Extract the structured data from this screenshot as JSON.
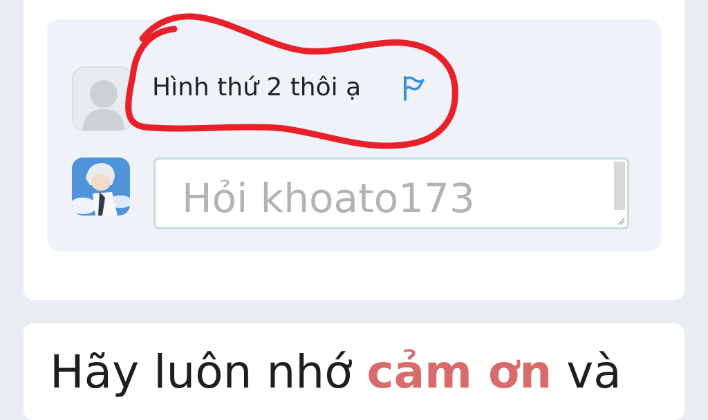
{
  "comment": {
    "text": "Hình thứ 2 thôi ạ",
    "report_icon": "flag-icon"
  },
  "ask_box": {
    "placeholder": "Hỏi khoato173"
  },
  "headline": {
    "part1": "Hãy luôn nhớ ",
    "accent": "cảm ơn",
    "part2": " và"
  },
  "colors": {
    "annotation_red": "#e8202a",
    "flag_blue": "#3a8fd9",
    "accent_red": "#d86b6b"
  }
}
